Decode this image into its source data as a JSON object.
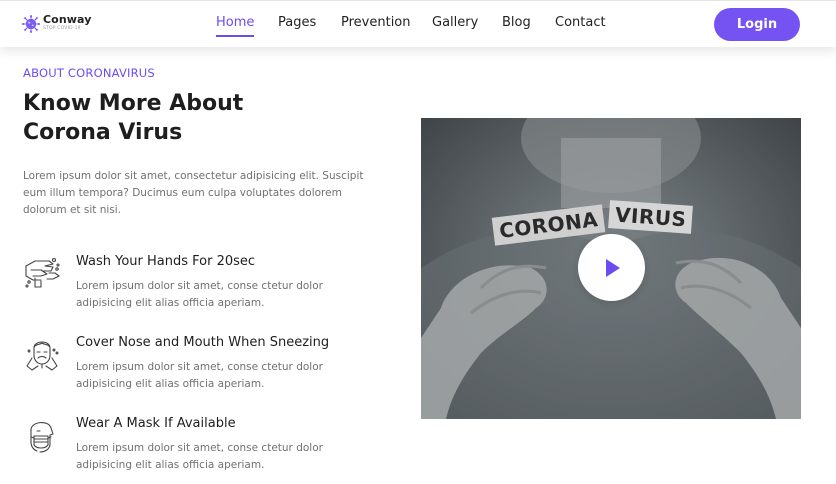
{
  "header": {
    "logo_name": "Conway",
    "logo_tagline": "STOP COVID-19",
    "nav": [
      {
        "label": "Home",
        "active": true
      },
      {
        "label": "Pages",
        "active": false
      },
      {
        "label": "Prevention",
        "active": false
      },
      {
        "label": "Gallery",
        "active": false
      },
      {
        "label": "Blog",
        "active": false
      },
      {
        "label": "Contact",
        "active": false
      }
    ],
    "login_label": "Login"
  },
  "about": {
    "eyebrow": "ABOUT CORONAVIRUS",
    "title_line1": "Know More About",
    "title_line2": "Corona Virus",
    "intro": "Lorem ipsum dolor sit amet, consectetur adipisicing elit. Suscipit eum illum tempora? Ducimus eum culpa voluptates dolorem dolorum et sit nisi."
  },
  "features": [
    {
      "icon": "wash-hands-icon",
      "title": "Wash Your Hands For 20sec",
      "description": "Lorem ipsum dolor sit amet, conse ctetur dolor adipisicing elit alias officia aperiam."
    },
    {
      "icon": "sneezing-person-icon",
      "title": "Cover Nose and Mouth When Sneezing",
      "description": "Lorem ipsum dolor sit amet, conse ctetur dolor adipisicing elit alias officia aperiam."
    },
    {
      "icon": "face-mask-icon",
      "title": "Wear A Mask If Available",
      "description": "Lorem ipsum dolor sit amet, conse ctetur dolor adipisicing elit alias officia aperiam."
    }
  ],
  "video": {
    "card_left": "CORONA",
    "card_right": "VIRUS",
    "play_icon": "play-icon"
  },
  "colors": {
    "accent": "#6c4bf0",
    "button": "#7453f2",
    "heading": "#1e1e1e",
    "body_text": "#707070"
  }
}
